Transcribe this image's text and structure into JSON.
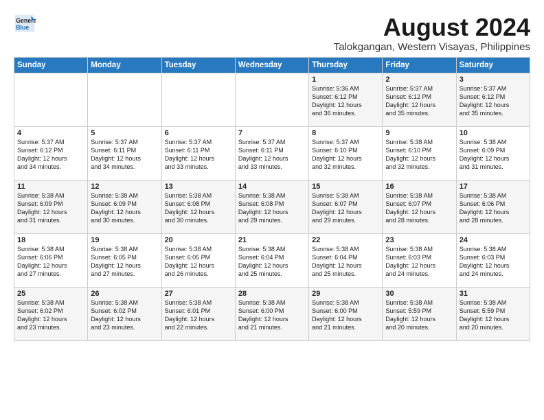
{
  "logo": {
    "line1": "General",
    "line2": "Blue"
  },
  "title": "August 2024",
  "location": "Talokgangan, Western Visayas, Philippines",
  "days_of_week": [
    "Sunday",
    "Monday",
    "Tuesday",
    "Wednesday",
    "Thursday",
    "Friday",
    "Saturday"
  ],
  "weeks": [
    [
      {
        "day": "",
        "text": ""
      },
      {
        "day": "",
        "text": ""
      },
      {
        "day": "",
        "text": ""
      },
      {
        "day": "",
        "text": ""
      },
      {
        "day": "1",
        "text": "Sunrise: 5:36 AM\nSunset: 6:12 PM\nDaylight: 12 hours\nand 36 minutes."
      },
      {
        "day": "2",
        "text": "Sunrise: 5:37 AM\nSunset: 6:12 PM\nDaylight: 12 hours\nand 35 minutes."
      },
      {
        "day": "3",
        "text": "Sunrise: 5:37 AM\nSunset: 6:12 PM\nDaylight: 12 hours\nand 35 minutes."
      }
    ],
    [
      {
        "day": "4",
        "text": "Sunrise: 5:37 AM\nSunset: 6:12 PM\nDaylight: 12 hours\nand 34 minutes."
      },
      {
        "day": "5",
        "text": "Sunrise: 5:37 AM\nSunset: 6:11 PM\nDaylight: 12 hours\nand 34 minutes."
      },
      {
        "day": "6",
        "text": "Sunrise: 5:37 AM\nSunset: 6:11 PM\nDaylight: 12 hours\nand 33 minutes."
      },
      {
        "day": "7",
        "text": "Sunrise: 5:37 AM\nSunset: 6:11 PM\nDaylight: 12 hours\nand 33 minutes."
      },
      {
        "day": "8",
        "text": "Sunrise: 5:37 AM\nSunset: 6:10 PM\nDaylight: 12 hours\nand 32 minutes."
      },
      {
        "day": "9",
        "text": "Sunrise: 5:38 AM\nSunset: 6:10 PM\nDaylight: 12 hours\nand 32 minutes."
      },
      {
        "day": "10",
        "text": "Sunrise: 5:38 AM\nSunset: 6:09 PM\nDaylight: 12 hours\nand 31 minutes."
      }
    ],
    [
      {
        "day": "11",
        "text": "Sunrise: 5:38 AM\nSunset: 6:09 PM\nDaylight: 12 hours\nand 31 minutes."
      },
      {
        "day": "12",
        "text": "Sunrise: 5:38 AM\nSunset: 6:09 PM\nDaylight: 12 hours\nand 30 minutes."
      },
      {
        "day": "13",
        "text": "Sunrise: 5:38 AM\nSunset: 6:08 PM\nDaylight: 12 hours\nand 30 minutes."
      },
      {
        "day": "14",
        "text": "Sunrise: 5:38 AM\nSunset: 6:08 PM\nDaylight: 12 hours\nand 29 minutes."
      },
      {
        "day": "15",
        "text": "Sunrise: 5:38 AM\nSunset: 6:07 PM\nDaylight: 12 hours\nand 29 minutes."
      },
      {
        "day": "16",
        "text": "Sunrise: 5:38 AM\nSunset: 6:07 PM\nDaylight: 12 hours\nand 28 minutes."
      },
      {
        "day": "17",
        "text": "Sunrise: 5:38 AM\nSunset: 6:06 PM\nDaylight: 12 hours\nand 28 minutes."
      }
    ],
    [
      {
        "day": "18",
        "text": "Sunrise: 5:38 AM\nSunset: 6:06 PM\nDaylight: 12 hours\nand 27 minutes."
      },
      {
        "day": "19",
        "text": "Sunrise: 5:38 AM\nSunset: 6:05 PM\nDaylight: 12 hours\nand 27 minutes."
      },
      {
        "day": "20",
        "text": "Sunrise: 5:38 AM\nSunset: 6:05 PM\nDaylight: 12 hours\nand 26 minutes."
      },
      {
        "day": "21",
        "text": "Sunrise: 5:38 AM\nSunset: 6:04 PM\nDaylight: 12 hours\nand 25 minutes."
      },
      {
        "day": "22",
        "text": "Sunrise: 5:38 AM\nSunset: 6:04 PM\nDaylight: 12 hours\nand 25 minutes."
      },
      {
        "day": "23",
        "text": "Sunrise: 5:38 AM\nSunset: 6:03 PM\nDaylight: 12 hours\nand 24 minutes."
      },
      {
        "day": "24",
        "text": "Sunrise: 5:38 AM\nSunset: 6:03 PM\nDaylight: 12 hours\nand 24 minutes."
      }
    ],
    [
      {
        "day": "25",
        "text": "Sunrise: 5:38 AM\nSunset: 6:02 PM\nDaylight: 12 hours\nand 23 minutes."
      },
      {
        "day": "26",
        "text": "Sunrise: 5:38 AM\nSunset: 6:02 PM\nDaylight: 12 hours\nand 23 minutes."
      },
      {
        "day": "27",
        "text": "Sunrise: 5:38 AM\nSunset: 6:01 PM\nDaylight: 12 hours\nand 22 minutes."
      },
      {
        "day": "28",
        "text": "Sunrise: 5:38 AM\nSunset: 6:00 PM\nDaylight: 12 hours\nand 21 minutes."
      },
      {
        "day": "29",
        "text": "Sunrise: 5:38 AM\nSunset: 6:00 PM\nDaylight: 12 hours\nand 21 minutes."
      },
      {
        "day": "30",
        "text": "Sunrise: 5:38 AM\nSunset: 5:59 PM\nDaylight: 12 hours\nand 20 minutes."
      },
      {
        "day": "31",
        "text": "Sunrise: 5:38 AM\nSunset: 5:59 PM\nDaylight: 12 hours\nand 20 minutes."
      }
    ]
  ]
}
